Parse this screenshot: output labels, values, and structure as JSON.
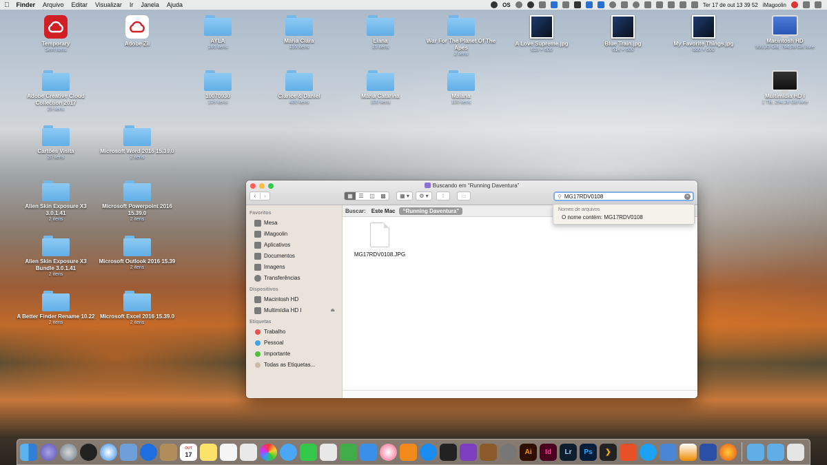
{
  "menubar": {
    "apple_icon": "apple-icon",
    "items": [
      "Finder",
      "Arquivo",
      "Editar",
      "Visualizar",
      "Ir",
      "Janela",
      "Ajuda"
    ],
    "status_texts": [
      "OS"
    ],
    "clock": "Ter 17 de out  13 39 52",
    "user": "iMagoolin"
  },
  "desktop": [
    {
      "label": "Temporary",
      "sub": "Sem itens",
      "kind": "cc-red"
    },
    {
      "label": "Adobe Zii",
      "sub": "",
      "kind": "cc-white"
    },
    {
      "label": "AYLA",
      "sub": "165 itens",
      "kind": "folder"
    },
    {
      "label": "Maria Clara",
      "sub": "155 itens",
      "kind": "folder"
    },
    {
      "label": "Liana",
      "sub": "15 itens",
      "kind": "folder"
    },
    {
      "label": "War For The Planet Of The Apes",
      "sub": "2 itens",
      "kind": "folder"
    },
    {
      "label": "A Love Supreme.jpg",
      "sub": "618 × 600",
      "kind": "image"
    },
    {
      "label": "Blue Train.jpg",
      "sub": "614 × 600",
      "kind": "image"
    },
    {
      "label": "My Favorite Things.jpg",
      "sub": "600 × 600",
      "kind": "image"
    },
    {
      "label": "Macintosh HD",
      "sub": "999,35 GB, 764,08 GB livre",
      "kind": "disk"
    },
    {
      "label": "Adobe Creative Cloud Collection 2017",
      "sub": "29 itens",
      "kind": "folder"
    },
    {
      "label": "10070930",
      "sub": "109 itens",
      "kind": "folder"
    },
    {
      "label": "Clarice & Daniel",
      "sub": "400 itens",
      "kind": "folder"
    },
    {
      "label": "Maria Catarina",
      "sub": "100 itens",
      "kind": "folder"
    },
    {
      "label": "Maiana",
      "sub": "100 itens",
      "kind": "folder"
    },
    {
      "label": "Multimídia HD I",
      "sub": "1 TB, 294,28 GB livre",
      "kind": "disk-dark"
    },
    {
      "label": "Cartões Visita",
      "sub": "20 itens",
      "kind": "folder"
    },
    {
      "label": "Microsoft Word 2016 15.39.0",
      "sub": "2 itens",
      "kind": "folder"
    },
    {
      "label": "Alien Skin Exposure X3 3.0.1.41",
      "sub": "2 itens",
      "kind": "folder"
    },
    {
      "label": "Microsoft Powerpoint 2016 15.39.0",
      "sub": "2 itens",
      "kind": "folder"
    },
    {
      "label": "Alien Skin Exposure X3 Bundle 3.0.1.41",
      "sub": "2 itens",
      "kind": "folder"
    },
    {
      "label": "Microsoft Outlook 2016 15.39",
      "sub": "2 itens",
      "kind": "folder"
    },
    {
      "label": "A Better Finder Rename 10.22",
      "sub": "2 itens",
      "kind": "folder"
    },
    {
      "label": "Microsoft Excel 2016 15.39.0",
      "sub": "2 itens",
      "kind": "folder"
    }
  ],
  "finder": {
    "title": "Buscando em “Running Daventura”",
    "search_value": "MG17RDV0108",
    "scope_label": "Buscar:",
    "scope_this_mac": "Este Mac",
    "scope_folder": "“Running Daventura”",
    "sidebar": {
      "favorites_title": "Favoritos",
      "favorites": [
        "Mesa",
        "iMagoolin",
        "Aplicativos",
        "Documentos",
        "Imagens",
        "Transferências"
      ],
      "devices_title": "Dispositivos",
      "devices": [
        "Macintosh HD",
        "Multimídia HD I"
      ],
      "tags_title": "Etiquetas",
      "tags": [
        {
          "label": "Trabalho",
          "color": "#e8504b"
        },
        {
          "label": "Pessoal",
          "color": "#3fa3ea"
        },
        {
          "label": "Importante",
          "color": "#4cc23a"
        },
        {
          "label": "Todas as Etiquetas...",
          "color": "#c9bba8"
        }
      ]
    },
    "results": [
      {
        "name": "MG17RDV0108.JPG"
      }
    ],
    "suggestions": {
      "header": "Nomes de arquivos",
      "item": "O nome contém: MG17RDV0108"
    }
  },
  "dock": {
    "ai_label": "Ai",
    "id_label": "Id",
    "lr_label": "Lr",
    "ps_label": "Ps",
    "cal_day": "17",
    "cal_month": "OUT"
  }
}
